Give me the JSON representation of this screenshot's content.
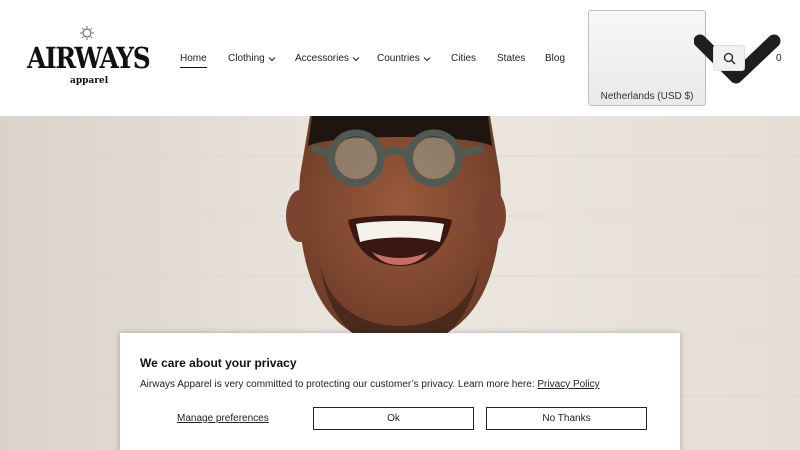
{
  "brand": {
    "name": "AIRWAYS",
    "sub": "apparel"
  },
  "nav": {
    "items": [
      {
        "label": "Home",
        "active": true
      },
      {
        "label": "Clothing",
        "dropdown": true
      },
      {
        "label": "Accessories",
        "dropdown": true
      },
      {
        "label": "Countries",
        "dropdown": true
      },
      {
        "label": "Cities"
      },
      {
        "label": "States"
      },
      {
        "label": "Blog"
      }
    ]
  },
  "country_selector": {
    "label": "Netherlands (USD $)"
  },
  "header_icons": {
    "search": "search-icon",
    "cart": "cart-icon",
    "cart_count": "0"
  },
  "hero": {
    "image": "smiling-man-with-glasses-photo"
  },
  "cookie_banner": {
    "title": "We care about your privacy",
    "text": "Airways Apparel is very committed to protecting our customer’s privacy. Learn more here: ",
    "link_label": "Privacy Policy",
    "manage_label": "Manage preferences",
    "ok_label": "Ok",
    "no_label": "No Thanks"
  }
}
